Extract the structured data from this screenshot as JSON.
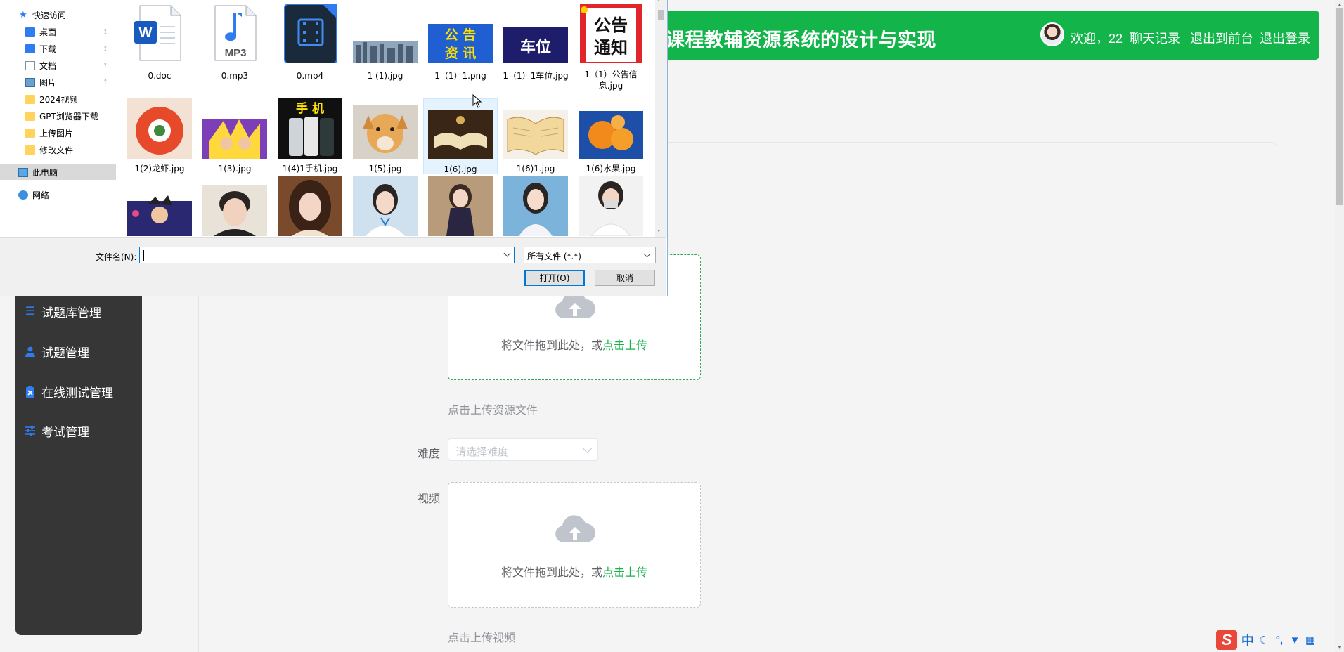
{
  "header": {
    "system_title": "课程教辅资源系统的设计与实现",
    "welcome": "欢迎，22",
    "chat_link": "聊天记录",
    "front_link": "退出到前台",
    "logout_link": "退出登录",
    "brand_color": "#13b54a"
  },
  "sidebar": {
    "items": [
      {
        "label": "试题库管理",
        "icon": "list-icon"
      },
      {
        "label": "试题管理",
        "icon": "user-icon"
      },
      {
        "label": "在线测试管理",
        "icon": "clipboard-icon"
      },
      {
        "label": "考试管理",
        "icon": "sliders-icon"
      }
    ]
  },
  "form": {
    "upload_resource": {
      "text": "将文件拖到此处，或",
      "link": "点击上传",
      "hint": "点击上传资源文件"
    },
    "difficulty": {
      "label": "难度",
      "placeholder": "请选择难度"
    },
    "video": {
      "label": "视频",
      "text": "将文件拖到此处，或",
      "link": "点击上传",
      "hint": "点击上传视频"
    }
  },
  "file_dialog": {
    "nav": [
      {
        "label": "快速访问",
        "icon": "star-icon",
        "pinned": false
      },
      {
        "label": "桌面",
        "icon": "desktop-icon",
        "pinned": true
      },
      {
        "label": "下载",
        "icon": "download-icon",
        "pinned": true
      },
      {
        "label": "文档",
        "icon": "document-icon",
        "pinned": true
      },
      {
        "label": "图片",
        "icon": "pictures-icon",
        "pinned": true
      },
      {
        "label": "2024视频",
        "icon": "folder-icon",
        "pinned": false
      },
      {
        "label": "GPT浏览器下载",
        "icon": "folder-icon",
        "pinned": false
      },
      {
        "label": "上传图片",
        "icon": "folder-icon",
        "pinned": false
      },
      {
        "label": "修改文件",
        "icon": "folder-icon",
        "pinned": false
      },
      {
        "label": "此电脑",
        "icon": "computer-icon",
        "pinned": false
      },
      {
        "label": "网络",
        "icon": "network-icon",
        "pinned": false
      }
    ],
    "files": [
      {
        "name": "0.doc",
        "kind": "word"
      },
      {
        "name": "0.mp3",
        "kind": "mp3"
      },
      {
        "name": "0.mp4",
        "kind": "video"
      },
      {
        "name": "1 (1).jpg",
        "kind": "city"
      },
      {
        "name": "1（1）1.png",
        "kind": "notice",
        "text1": "公 告",
        "text2": "资 讯"
      },
      {
        "name": "1（1）1车位.jpg",
        "kind": "parking",
        "text1": "车位"
      },
      {
        "name": "1（1）公告信息.jpg",
        "kind": "announce",
        "text1": "公告",
        "text2": "通知"
      },
      {
        "name": "1(2)龙虾.jpg",
        "kind": "food"
      },
      {
        "name": "1(3).jpg",
        "kind": "anime"
      },
      {
        "name": "1(4)1手机.jpg",
        "kind": "phone",
        "text1": "手 机"
      },
      {
        "name": "1(5).jpg",
        "kind": "dog"
      },
      {
        "name": "1(6).jpg",
        "kind": "book"
      },
      {
        "name": "1(6)1.jpg",
        "kind": "book2"
      },
      {
        "name": "1(6)水果.jpg",
        "kind": "fruit"
      },
      {
        "name": "",
        "kind": "goku"
      },
      {
        "name": "",
        "kind": "boy"
      },
      {
        "name": "",
        "kind": "girl1"
      },
      {
        "name": "",
        "kind": "doctor1"
      },
      {
        "name": "",
        "kind": "girl2"
      },
      {
        "name": "",
        "kind": "girl3"
      },
      {
        "name": "",
        "kind": "doctor2"
      }
    ],
    "filename_label": "文件名(N):",
    "filename_value": "",
    "filter": "所有文件 (*.*)",
    "open_button": "打开(O)",
    "cancel_button": "取消"
  },
  "ime": {
    "lang": "中",
    "punct": "°,"
  }
}
